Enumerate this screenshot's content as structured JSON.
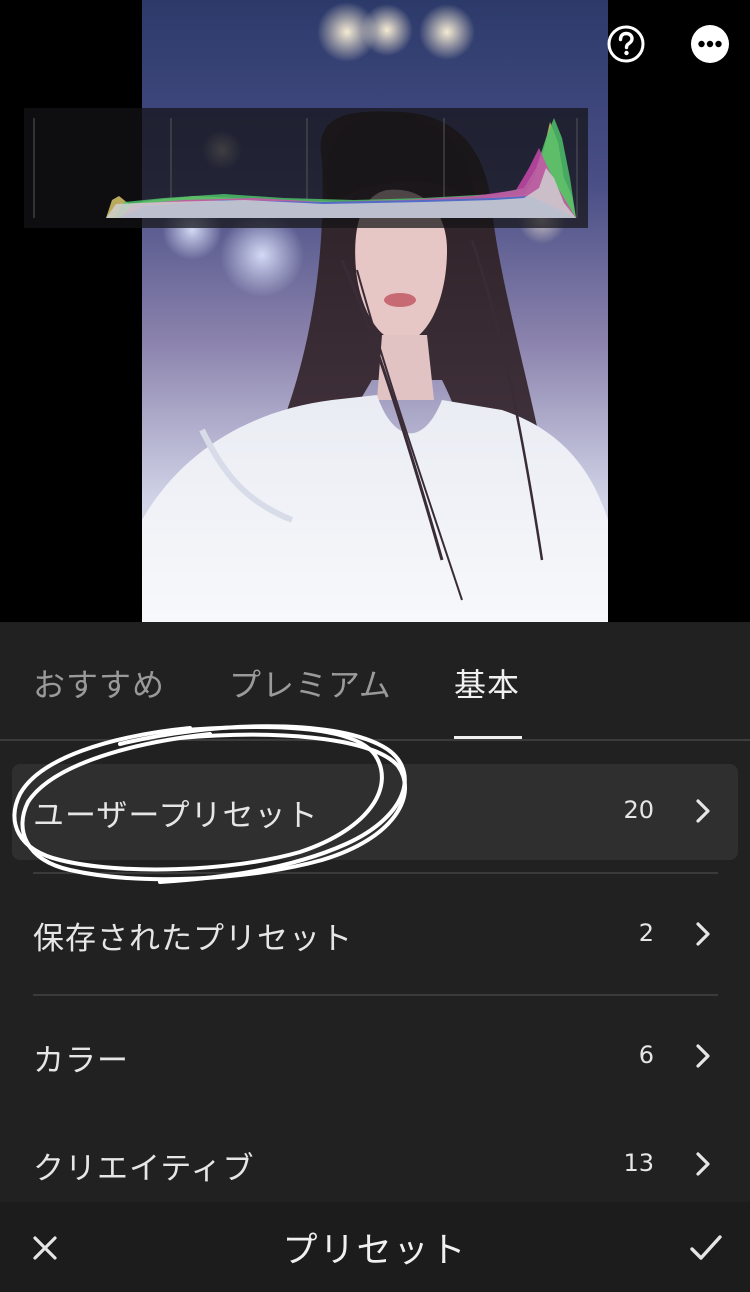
{
  "photo": {
    "description_icon": "portrait-photo"
  },
  "top_icons": {
    "help": "help-circle-icon",
    "more": "more-options-icon"
  },
  "tabs": [
    {
      "label": "おすすめ",
      "active": false
    },
    {
      "label": "プレミアム",
      "active": false
    },
    {
      "label": "基本",
      "active": true
    }
  ],
  "preset_groups": [
    {
      "label": "ユーザープリセット",
      "count": "20",
      "highlighted": true
    },
    {
      "label": "保存されたプリセット",
      "count": "2",
      "highlighted": false
    },
    {
      "label": "カラー",
      "count": "6",
      "highlighted": false
    },
    {
      "label": "クリエイティブ",
      "count": "13",
      "highlighted": false
    }
  ],
  "bottom_bar": {
    "title": "プリセット",
    "cancel_icon": "close-icon",
    "apply_icon": "checkmark-icon"
  },
  "colors": {
    "panel": "#212121",
    "highlight_row": "#2f2f2f",
    "annotation": "#ffffff"
  }
}
